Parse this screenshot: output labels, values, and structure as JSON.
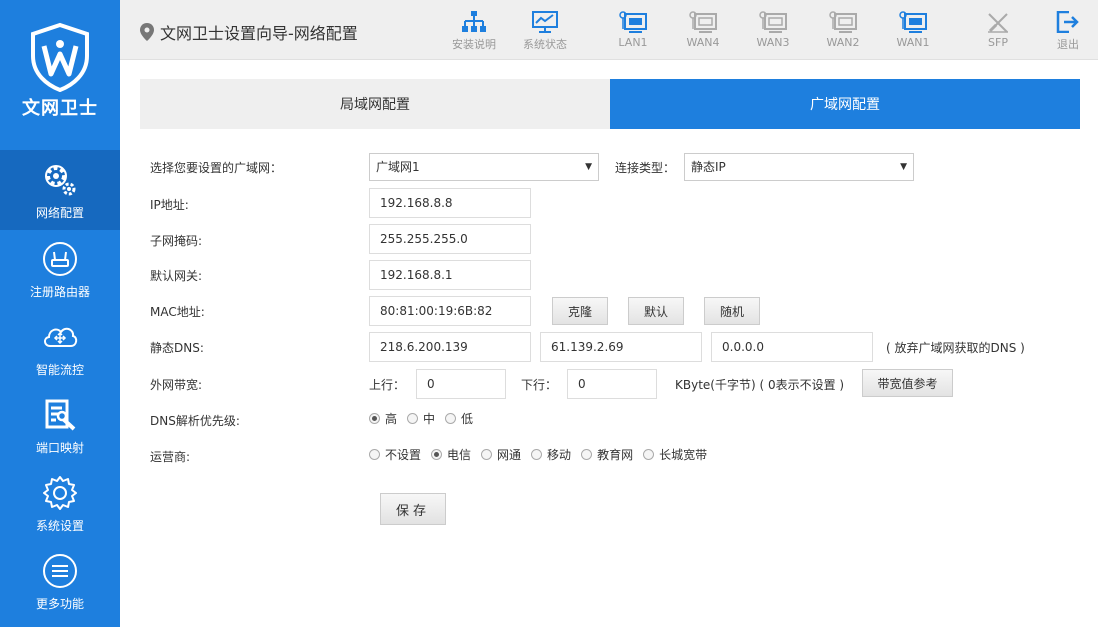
{
  "sidebar": {
    "logo_text": "文网卫士",
    "items": [
      {
        "label": "网络配置"
      },
      {
        "label": "注册路由器"
      },
      {
        "label": "智能流控"
      },
      {
        "label": "端口映射"
      },
      {
        "label": "系统设置"
      },
      {
        "label": "更多功能"
      }
    ]
  },
  "header": {
    "title": "文网卫士设置向导-网络配置",
    "toolbar": [
      {
        "label": "安装说明",
        "icon": "network-tree-icon"
      },
      {
        "label": "系统状态",
        "icon": "monitor-chart-icon"
      },
      {
        "label": "LAN1",
        "icon": "port-active-icon"
      },
      {
        "label": "WAN4",
        "icon": "port-inactive-icon"
      },
      {
        "label": "WAN3",
        "icon": "port-inactive-icon"
      },
      {
        "label": "WAN2",
        "icon": "port-inactive-icon"
      },
      {
        "label": "WAN1",
        "icon": "port-active-icon"
      },
      {
        "label": "SFP",
        "icon": "sfp-icon"
      },
      {
        "label": "退出",
        "icon": "logout-icon"
      }
    ]
  },
  "tabs": {
    "lan": "局域网配置",
    "wan": "广域网配置"
  },
  "form": {
    "wan_select_label": "选择您要设置的广域网：",
    "wan_select_value": "广域网1",
    "conn_type_label": "连接类型：",
    "conn_type_value": "静态IP",
    "ip_label": "IP地址:",
    "ip_value": "192.168.8.8",
    "mask_label": "子网掩码:",
    "mask_value": "255.255.255.0",
    "gateway_label": "默认网关:",
    "gateway_value": "192.168.8.1",
    "mac_label": "MAC地址:",
    "mac_value": "80:81:00:19:6B:82",
    "btn_clone": "克隆",
    "btn_default": "默认",
    "btn_random": "随机",
    "dns_label": "静态DNS:",
    "dns1": "218.6.200.139",
    "dns2": "61.139.2.69",
    "dns3": "0.0.0.0",
    "dns_note": "( 放弃广域网获取的DNS )",
    "bw_label": "外网带宽:",
    "up_label": "上行：",
    "up_value": "0",
    "down_label": "下行：",
    "down_value": "0",
    "bw_unit": "KByte(千字节) ( 0表示不设置 )",
    "bw_ref_btn": "带宽值参考",
    "dns_priority_label": "DNS解析优先级:",
    "dns_priority_options": [
      "高",
      "中",
      "低"
    ],
    "dns_priority_selected": 0,
    "isp_label": "运营商:",
    "isp_options": [
      "不设置",
      "电信",
      "网通",
      "移动",
      "教育网",
      "长城宽带"
    ],
    "isp_selected": 1,
    "save": "保存"
  },
  "colors": {
    "primary": "#1e7fde",
    "active_nav": "#1669bf",
    "port_active": "#1e7fde",
    "port_inactive": "#aaaaaa"
  }
}
